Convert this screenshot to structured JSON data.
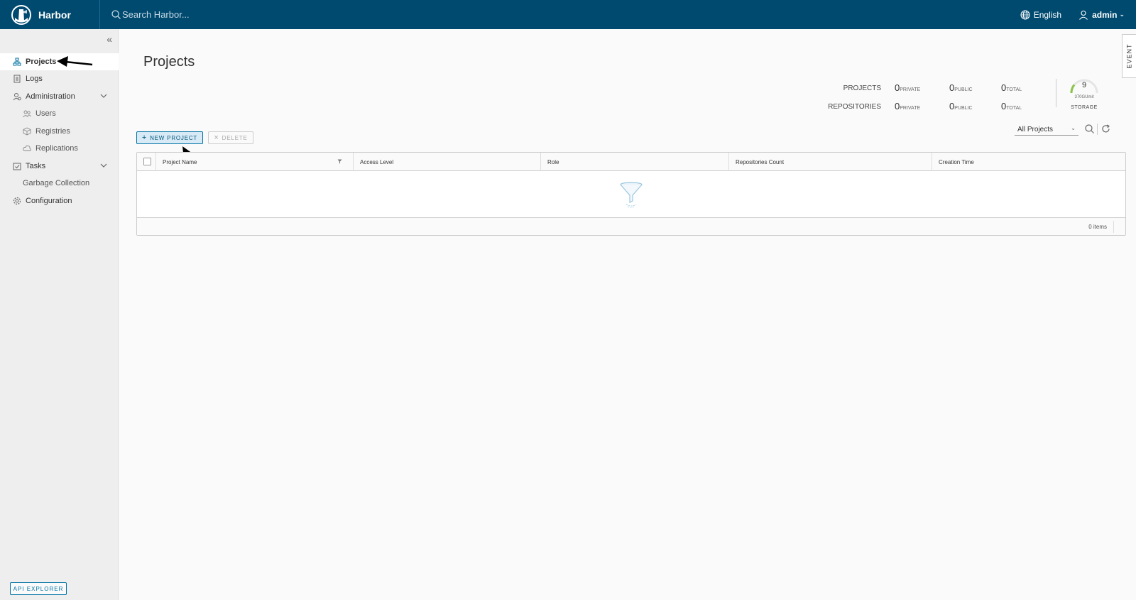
{
  "header": {
    "app_name": "Harbor",
    "search_placeholder": "Search Harbor...",
    "language": "English",
    "user": "admin"
  },
  "sidebar": {
    "items": [
      {
        "label": "Projects",
        "icon": "projects-icon"
      },
      {
        "label": "Logs",
        "icon": "logs-icon"
      },
      {
        "label": "Administration",
        "icon": "administration-icon"
      },
      {
        "label": "Users",
        "icon": "users-icon"
      },
      {
        "label": "Registries",
        "icon": "registries-icon"
      },
      {
        "label": "Replications",
        "icon": "replications-icon"
      },
      {
        "label": "Tasks",
        "icon": "tasks-icon"
      },
      {
        "label": "Garbage Collection"
      },
      {
        "label": "Configuration",
        "icon": "gear-icon"
      }
    ],
    "api_explorer": "API EXPLORER"
  },
  "main": {
    "title": "Projects",
    "event_tab": "EVENT",
    "stats": {
      "projects_label": "PROJECTS",
      "repositories_label": "REPOSITORIES",
      "projects": {
        "private": "0",
        "public": "0",
        "total": "0"
      },
      "repositories": {
        "private": "0",
        "public": "0",
        "total": "0"
      },
      "private_label": "PRIVATE",
      "public_label": "PUBLIC",
      "total_label": "TOTAL"
    },
    "storage": {
      "value": "9",
      "limit": "370GUmit",
      "label": "STORAGE"
    },
    "toolbar": {
      "new_project": "NEW PROJECT",
      "delete": "DELETE",
      "filter_selected": "All Projects"
    },
    "grid": {
      "columns": [
        "Project Name",
        "Access Level",
        "Role",
        "Repositories Count",
        "Creation Time"
      ],
      "footer": "0 items"
    }
  },
  "colors": {
    "header_bg": "#004a70",
    "accent": "#0072a3",
    "gauge": "#8bc34a"
  }
}
